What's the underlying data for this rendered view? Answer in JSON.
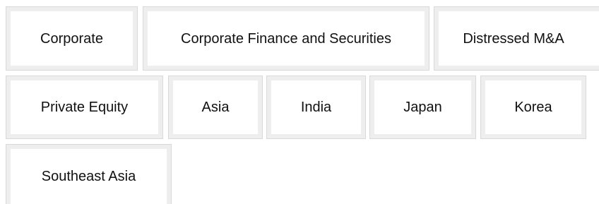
{
  "tags": [
    {
      "label": "Corporate"
    },
    {
      "label": "Corporate Finance and Securities"
    },
    {
      "label": "Distressed M&A"
    },
    {
      "label": "Private Equity"
    },
    {
      "label": "Asia"
    },
    {
      "label": "India"
    },
    {
      "label": "Japan"
    },
    {
      "label": "Korea"
    },
    {
      "label": "Southeast Asia"
    }
  ]
}
